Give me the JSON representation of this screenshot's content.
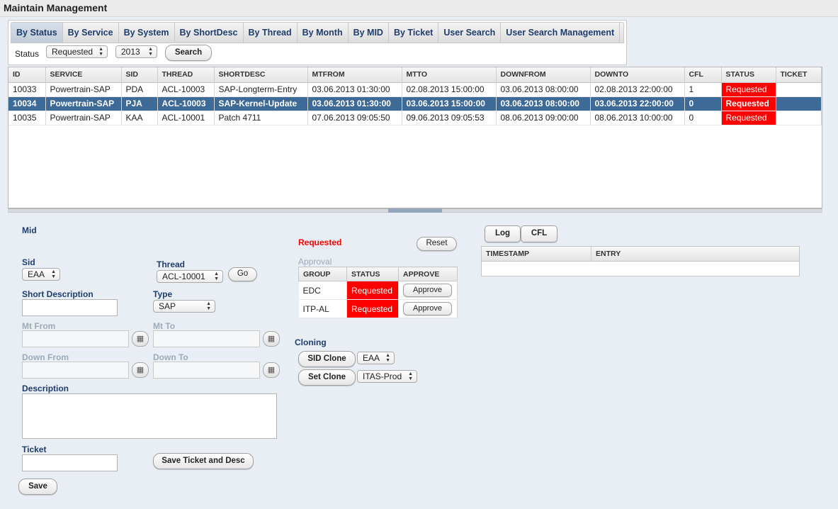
{
  "page": {
    "title": "Maintain Management"
  },
  "tabs": [
    {
      "label": "By Status",
      "active": true
    },
    {
      "label": "By Service"
    },
    {
      "label": "By System"
    },
    {
      "label": "By ShortDesc"
    },
    {
      "label": "By Thread"
    },
    {
      "label": "By Month"
    },
    {
      "label": "By MID"
    },
    {
      "label": "By Ticket"
    },
    {
      "label": "User Search"
    },
    {
      "label": "User Search Management"
    }
  ],
  "filter": {
    "status_label": "Status",
    "status_value": "Requested",
    "year_value": "2013",
    "search_label": "Search"
  },
  "grid": {
    "columns": [
      "ID",
      "SERVICE",
      "SID",
      "THREAD",
      "SHORTDESC",
      "MTFROM",
      "MTTO",
      "DOWNFROM",
      "DOWNTO",
      "CFL",
      "STATUS",
      "TICKET"
    ],
    "rows": [
      [
        "10033",
        "Powertrain-SAP",
        "PDA",
        "ACL-10003",
        "SAP-Longterm-Entry",
        "03.06.2013 01:30:00",
        "02.08.2013 15:00:00",
        "03.06.2013 08:00:00",
        "02.08.2013 22:00:00",
        "1",
        "Requested",
        ""
      ],
      [
        "10034",
        "Powertrain-SAP",
        "PJA",
        "ACL-10003",
        "SAP-Kernel-Update",
        "03.06.2013 01:30:00",
        "03.06.2013 15:00:00",
        "03.06.2013 08:00:00",
        "03.06.2013 22:00:00",
        "0",
        "Requested",
        ""
      ],
      [
        "10035",
        "Powertrain-SAP",
        "KAA",
        "ACL-10001",
        "Patch 4711",
        "07.06.2013 09:05:50",
        "09.06.2013 09:05:53",
        "08.06.2013 09:00:00",
        "08.06.2013 10:00:00",
        "0",
        "Requested",
        ""
      ]
    ],
    "selected_row": 1
  },
  "form": {
    "mid_label": "Mid",
    "sid_label": "Sid",
    "sid_value": "EAA",
    "thread_label": "Thread",
    "thread_value": "ACL-10001",
    "go_label": "Go",
    "short_desc_label": "Short Description",
    "type_label": "Type",
    "type_value": "SAP",
    "mt_from_label": "Mt From",
    "mt_to_label": "Mt To",
    "down_from_label": "Down From",
    "down_to_label": "Down To",
    "description_label": "Description",
    "ticket_label": "Ticket",
    "save_ticket_label": "Save Ticket and Desc",
    "save_label": "Save"
  },
  "approval": {
    "status_text": "Requested",
    "reset_label": "Reset",
    "title": "Approval",
    "columns": [
      "GROUP",
      "STATUS",
      "APPROVE"
    ],
    "rows": [
      {
        "group": "EDC",
        "status": "Requested",
        "approve": "Approve"
      },
      {
        "group": "ITP-AL",
        "status": "Requested",
        "approve": "Approve"
      }
    ]
  },
  "cloning": {
    "title": "Cloning",
    "sid_clone_label": "SID Clone",
    "sid_clone_value": "EAA",
    "set_clone_label": "Set Clone",
    "set_clone_value": "ITAS-Prod"
  },
  "log": {
    "log_tab": "Log",
    "cfl_tab": "CFL",
    "columns": [
      "TIMESTAMP",
      "ENTRY"
    ]
  },
  "colors": {
    "status_red": "#ff0000",
    "selected_row": "#3e6a98",
    "label_blue": "#1f3c6e"
  }
}
